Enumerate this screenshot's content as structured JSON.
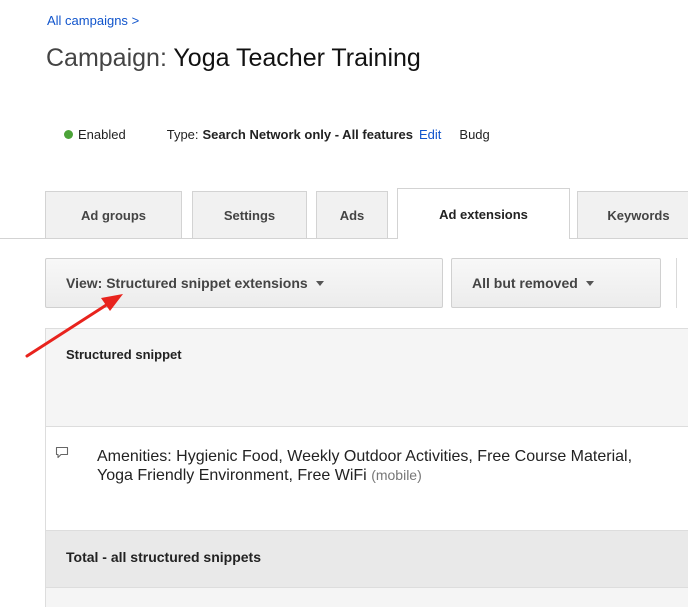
{
  "breadcrumb": {
    "link_label": "All campaigns",
    "separator": ">"
  },
  "campaign": {
    "title_prefix": "Campaign:",
    "name": "Yoga Teacher Training"
  },
  "status": {
    "label": "Enabled",
    "color": "#4ca338",
    "type_label": "Type:",
    "type_value": "Search Network only - All features",
    "edit_label": "Edit",
    "budget_label": "Budg"
  },
  "tabs": [
    {
      "label": "Ad groups",
      "active": false
    },
    {
      "label": "Settings",
      "active": false
    },
    {
      "label": "Ads",
      "active": false
    },
    {
      "label": "Ad extensions",
      "active": true
    },
    {
      "label": "Keywords",
      "active": false
    }
  ],
  "toolbar": {
    "view_dropdown": "View: Structured snippet extensions",
    "filter_dropdown": "All but removed"
  },
  "table": {
    "column_header": "Structured snippet",
    "rows": [
      {
        "text": "Amenities: Hygienic Food, Weekly Outdoor Activities, Free Course Material, Yoga Friendly Environment, Free WiFi",
        "device": "(mobile)",
        "icon": "comment-icon"
      }
    ],
    "total_label": "Total - all structured snippets"
  },
  "annotation": {
    "arrow_color": "#e8231d"
  }
}
